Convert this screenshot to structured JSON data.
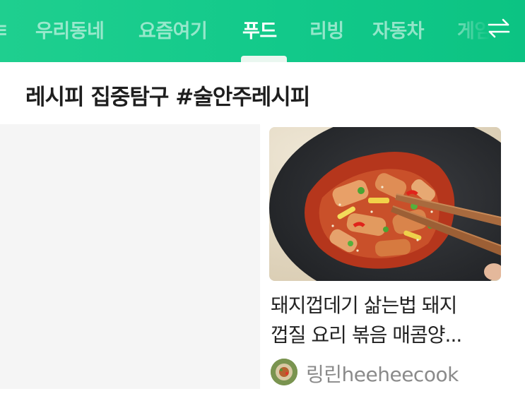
{
  "nav": {
    "tabs": [
      {
        "label": "우리동네",
        "active": false
      },
      {
        "label": "요즘여기",
        "active": false
      },
      {
        "label": "푸드",
        "active": true
      },
      {
        "label": "리빙",
        "active": false
      },
      {
        "label": "자동차",
        "active": false
      },
      {
        "label": "게임",
        "active": false
      }
    ],
    "swap_icon": "swap-arrows-icon"
  },
  "section": {
    "title": "레시피 집중탐구 #술안주레시피"
  },
  "card": {
    "title_line1": "돼지껍데기 삶는법 돼지",
    "title_line2": "껍질 요리 볶음 매콤양...",
    "author": "링린heeheecook"
  },
  "colors": {
    "brand_green": "#12c98a",
    "title_text": "#1e1e1e",
    "author_text": "#8a8a8a"
  }
}
